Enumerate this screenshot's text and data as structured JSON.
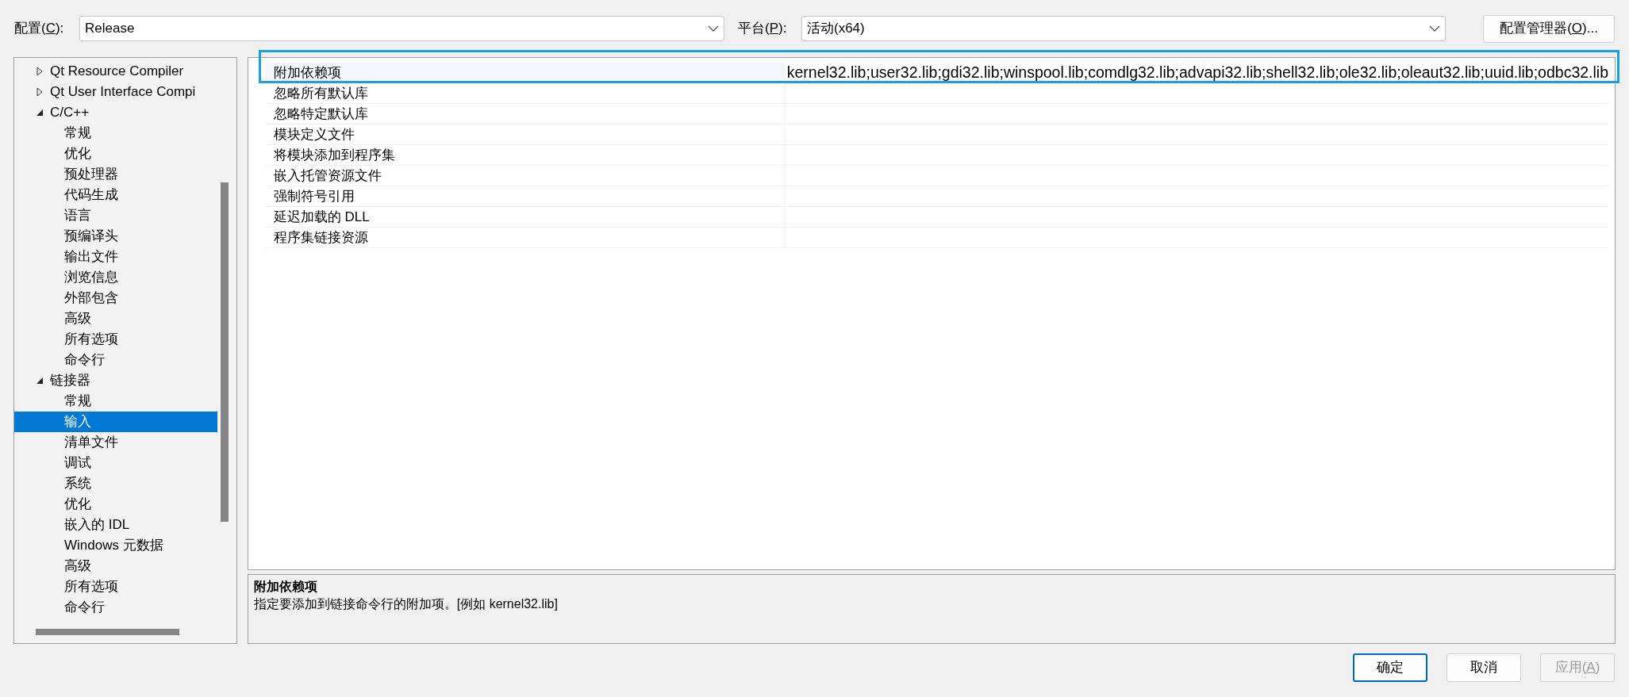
{
  "config": {
    "label_before": "配置(",
    "mnemonic": "C",
    "label_after": "):",
    "value": "Release"
  },
  "platform": {
    "label_before": "平台(",
    "mnemonic": "P",
    "label_after": "):",
    "value": "活动(x64)"
  },
  "config_manager_button": {
    "label_before": "配置管理器(",
    "mnemonic": "O",
    "label_after": ")..."
  },
  "tree": [
    {
      "label": "Qt Resource Compiler",
      "expanded": false,
      "selected": false
    },
    {
      "label": "Qt User Interface Compi",
      "expanded": false,
      "selected": false
    },
    {
      "label": "C/C++",
      "expanded": true,
      "selected": false,
      "children": [
        {
          "label": "常规",
          "selected": false
        },
        {
          "label": "优化",
          "selected": false
        },
        {
          "label": "预处理器",
          "selected": false
        },
        {
          "label": "代码生成",
          "selected": false
        },
        {
          "label": "语言",
          "selected": false
        },
        {
          "label": "预编译头",
          "selected": false
        },
        {
          "label": "输出文件",
          "selected": false
        },
        {
          "label": "浏览信息",
          "selected": false
        },
        {
          "label": "外部包含",
          "selected": false
        },
        {
          "label": "高级",
          "selected": false
        },
        {
          "label": "所有选项",
          "selected": false
        },
        {
          "label": "命令行",
          "selected": false
        }
      ]
    },
    {
      "label": "链接器",
      "expanded": true,
      "selected": false,
      "children": [
        {
          "label": "常规",
          "selected": false
        },
        {
          "label": "输入",
          "selected": true
        },
        {
          "label": "清单文件",
          "selected": false
        },
        {
          "label": "调试",
          "selected": false
        },
        {
          "label": "系统",
          "selected": false
        },
        {
          "label": "优化",
          "selected": false
        },
        {
          "label": "嵌入的 IDL",
          "selected": false
        },
        {
          "label": "Windows 元数据",
          "selected": false
        },
        {
          "label": "高级",
          "selected": false
        },
        {
          "label": "所有选项",
          "selected": false
        },
        {
          "label": "命令行",
          "selected": false
        }
      ]
    }
  ],
  "properties": [
    {
      "name": "附加依赖项",
      "value": "kernel32.lib;user32.lib;gdi32.lib;winspool.lib;comdlg32.lib;advapi32.lib;shell32.lib;ole32.lib;oleaut32.lib;uuid.lib;odbc32.lib",
      "selected": true
    },
    {
      "name": "忽略所有默认库",
      "selected": false
    },
    {
      "name": "忽略特定默认库",
      "selected": false
    },
    {
      "name": "模块定义文件",
      "selected": false
    },
    {
      "name": "将模块添加到程序集",
      "selected": false
    },
    {
      "name": "嵌入托管资源文件",
      "selected": false
    },
    {
      "name": "强制符号引用",
      "selected": false
    },
    {
      "name": "延迟加载的 DLL",
      "selected": false
    },
    {
      "name": "程序集链接资源",
      "selected": false
    }
  ],
  "description": {
    "title": "附加依赖项",
    "text": "指定要添加到链接命令行的附加项。[例如 kernel32.lib]"
  },
  "buttons": [
    {
      "label": "确定",
      "default": true,
      "disabled": false
    },
    {
      "label": "取消",
      "default": false,
      "disabled": false
    },
    {
      "label_before": "应用(",
      "mnemonic": "A",
      "label_after": ")",
      "default": false,
      "disabled": true
    }
  ]
}
